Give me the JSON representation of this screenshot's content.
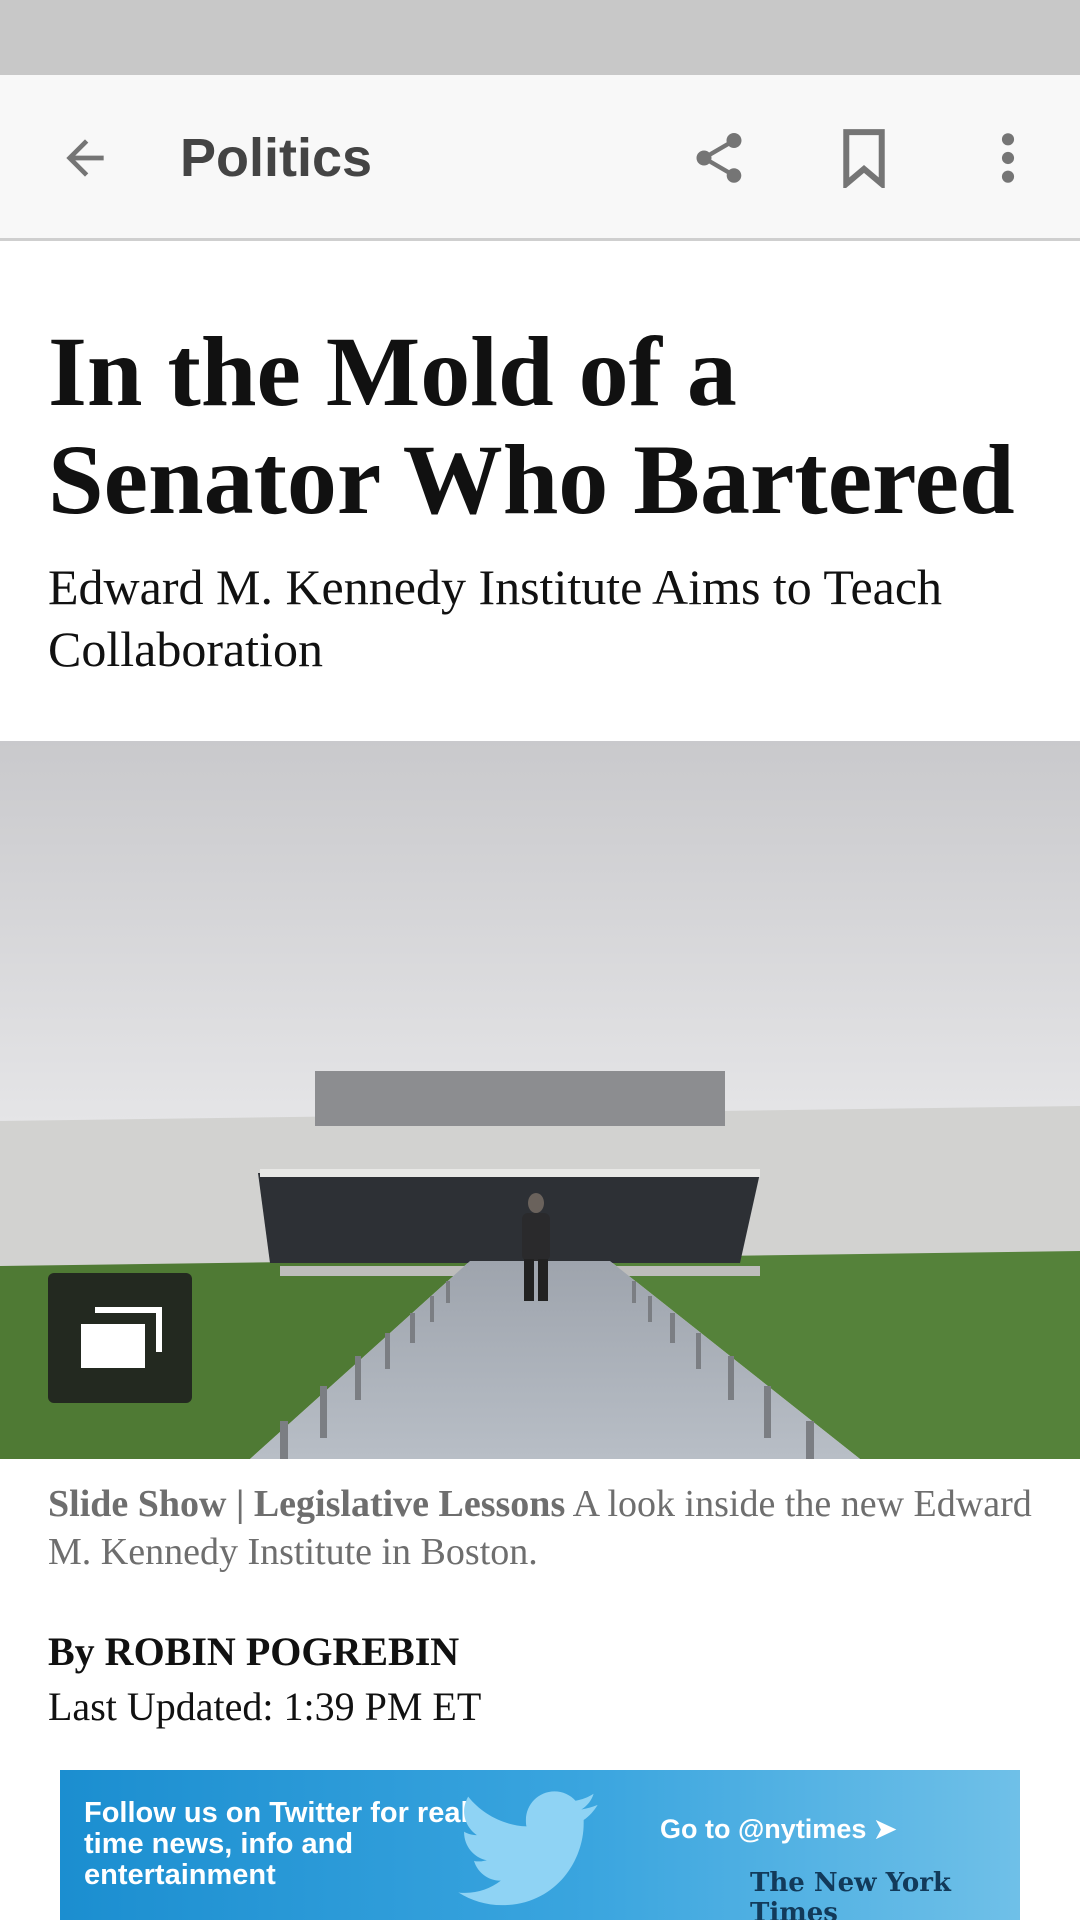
{
  "app_bar": {
    "section_title": "Politics",
    "icons": [
      "arrow-left-icon",
      "share-icon",
      "bookmark-icon",
      "more-vert-icon"
    ]
  },
  "article": {
    "headline": "In the Mold of a Senator Who Bartered",
    "subheadline": "Edward M. Kennedy Institute Aims to Teach Collaboration",
    "caption": {
      "label": "Slide Show | Legislative Lessons",
      "text": "A look inside the new Edward M. Kennedy Institute in Boston."
    },
    "byline": "By ROBIN POGREBIN",
    "updated": "Last Updated: 1:39 PM ET"
  },
  "ad": {
    "text": "Follow us on Twitter for real-time news, info and entertainment",
    "cta": "Go to @nytimes ➤",
    "brand": "The New York Times"
  },
  "colors": {
    "status_bar": "#c8c8c8",
    "app_bar": "#f8f8f8",
    "ad_blue": "#2a9ad8"
  }
}
